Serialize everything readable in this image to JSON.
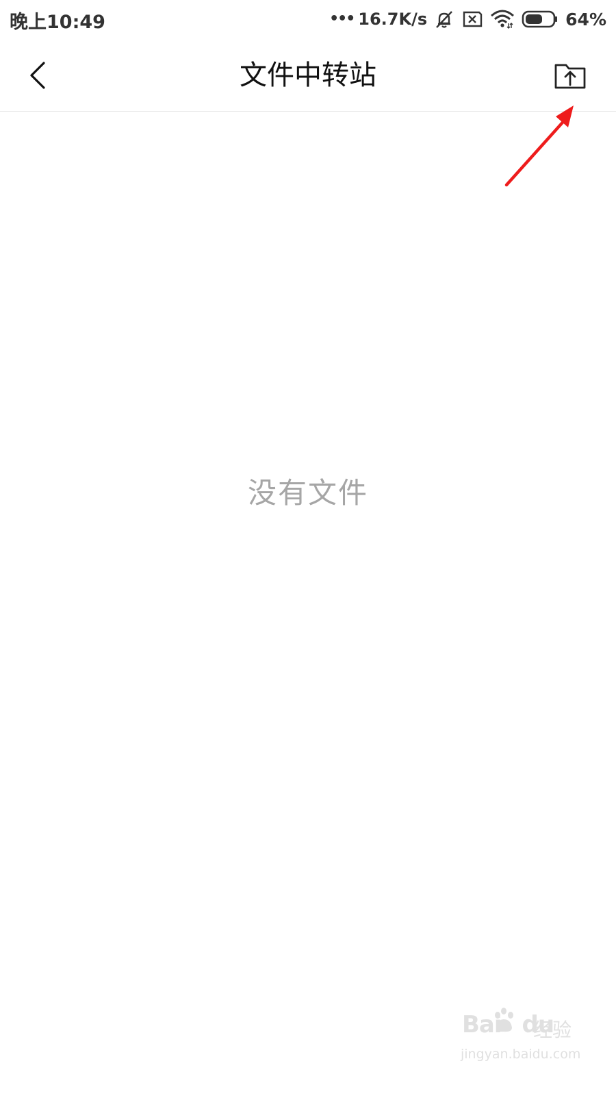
{
  "status_bar": {
    "time": "晚上10:49",
    "dots": "•••",
    "net_speed": "16.7K/s",
    "battery_percent": "64%",
    "icons": [
      "bell-muted-icon",
      "sim-off-icon",
      "wifi-icon",
      "battery-icon"
    ],
    "battery_level": 0.64
  },
  "nav": {
    "back_icon": "chevron-left-icon",
    "title": "文件中转站",
    "upload_icon": "folder-upload-icon"
  },
  "annotation": {
    "arrow_color": "#ee1c1c"
  },
  "content": {
    "empty_text": "没有文件"
  },
  "watermark": {
    "brand": "Bai",
    "brand_suffix": "du",
    "cn": "经验",
    "url": "jingyan.baidu.com"
  }
}
